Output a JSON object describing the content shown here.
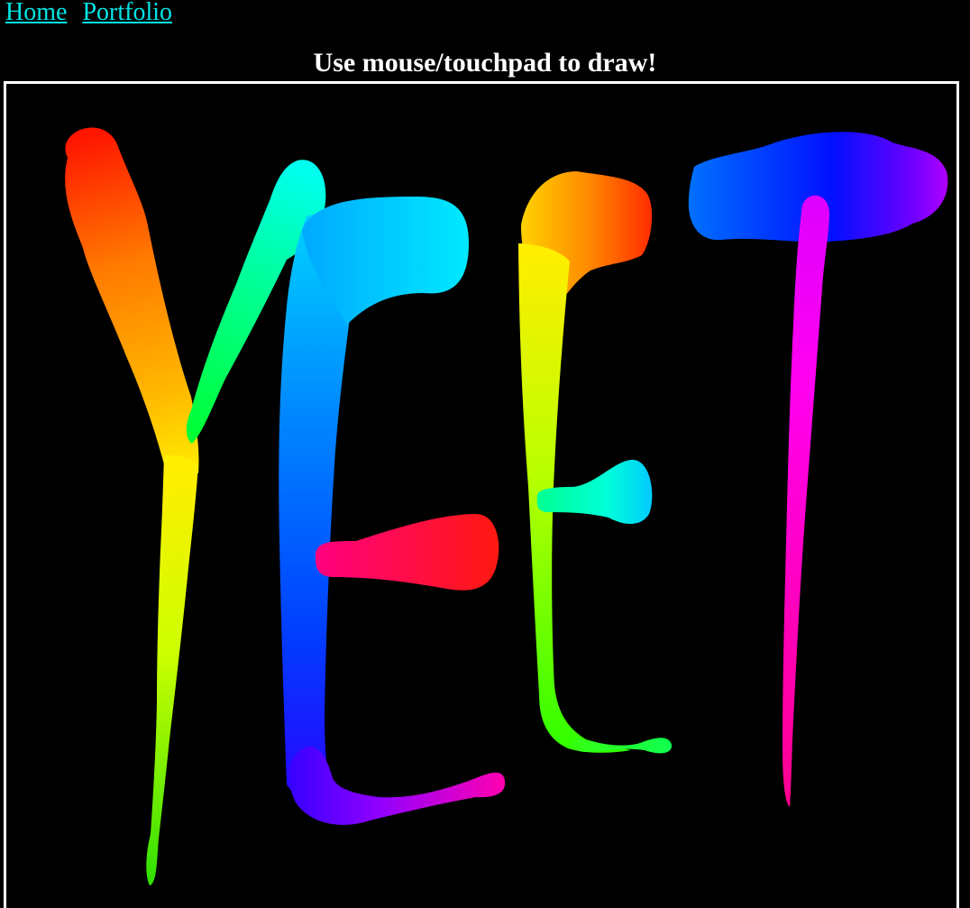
{
  "nav": {
    "links": [
      {
        "label": "Home"
      },
      {
        "label": "Portfolio"
      }
    ]
  },
  "header": {
    "instruction": "Use mouse/touchpad to draw!"
  },
  "canvas": {
    "background": "#000000",
    "border_color": "#ffffff",
    "drawn_text": "YEET",
    "stroke_style": "rainbow hue gradient"
  },
  "colors": {
    "link": "#00e5e5",
    "text": "#ffffff",
    "page_bg": "#000000"
  }
}
